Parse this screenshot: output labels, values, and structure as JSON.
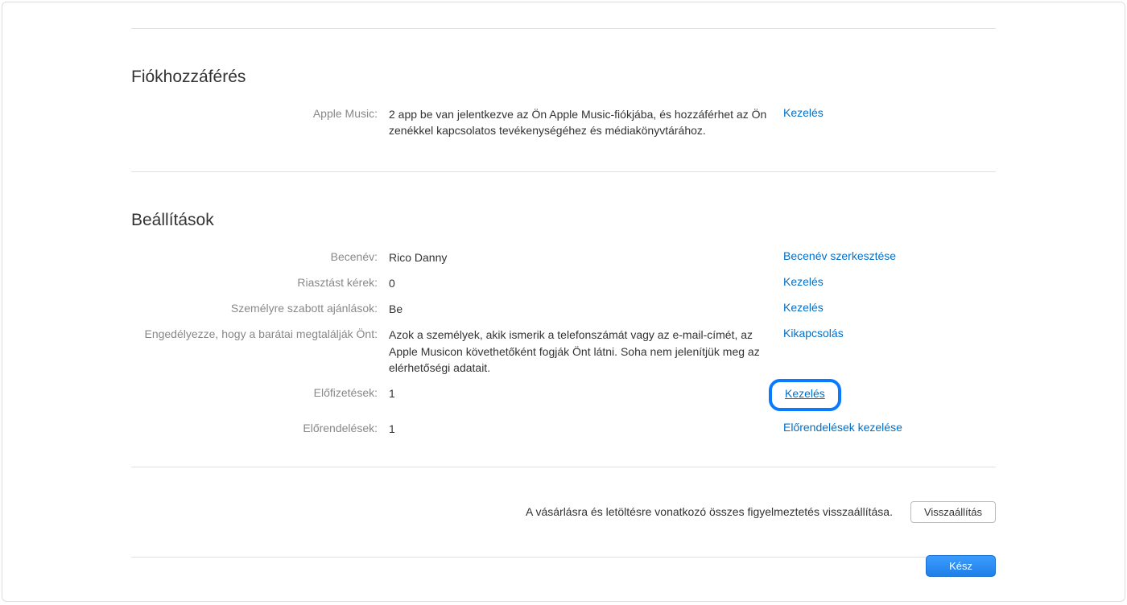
{
  "accountAccess": {
    "title": "Fiókhozzáférés",
    "appleMusic": {
      "label": "Apple Music:",
      "value": "2 app be van jelentkezve az Ön Apple Music-fiókjába, és hozzáférhet az Ön zenékkel kapcsolatos tevékenységéhez és médiakönyvtárához.",
      "action": "Kezelés"
    }
  },
  "settings": {
    "title": "Beállítások",
    "rows": {
      "nickname": {
        "label": "Becenév:",
        "value": "Rico Danny",
        "action": "Becenév szerkesztése"
      },
      "alert": {
        "label": "Riasztást kérek:",
        "value": "0",
        "action": "Kezelés"
      },
      "personalized": {
        "label": "Személyre szabott ajánlások:",
        "value": "Be",
        "action": "Kezelés"
      },
      "allowFriends": {
        "label": "Engedélyezze, hogy a barátai megtalálják Önt:",
        "value": "Azok a személyek, akik ismerik a telefonszámát vagy az e-mail-címét, az Apple Musicon követhetőként fogják Önt látni. Soha nem jelenítjük meg az elérhetőségi adatait.",
        "action": "Kikapcsolás"
      },
      "subscriptions": {
        "label": "Előfizetések:",
        "value": "1",
        "action": "Kezelés"
      },
      "preorders": {
        "label": "Előrendelések:",
        "value": "1",
        "action": "Előrendelések kezelése"
      }
    }
  },
  "resetRow": {
    "text": "A vásárlásra és letöltésre vonatkozó összes figyelmeztetés visszaállítása.",
    "button": "Visszaállítás"
  },
  "doneButton": "Kész"
}
